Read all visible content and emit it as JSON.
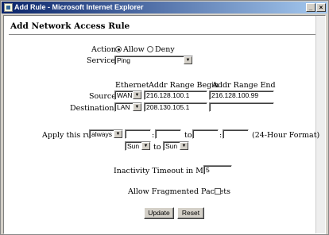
{
  "window": {
    "title": "Add Rule - Microsoft Internet Explorer"
  },
  "page": {
    "heading": "Add Network Access Rule"
  },
  "action": {
    "label": "Action",
    "options": [
      "Allow",
      "Deny"
    ],
    "selected": "Allow"
  },
  "service": {
    "label": "Service",
    "value": "Ping"
  },
  "columns": {
    "ethernet": "Ethernet",
    "begin": "Addr Range Begin",
    "end": "Addr Range End"
  },
  "source": {
    "label": "Source",
    "ethernet": "WAN",
    "begin": "216.128.100.1",
    "end": "216.128.100.99"
  },
  "destination": {
    "label": "Destination",
    "ethernet": "LAN",
    "begin": "208.130.105.1",
    "end": ""
  },
  "schedule": {
    "label": "Apply this rule",
    "mode": "always",
    "start_hour": "",
    "start_min": "",
    "to": "to",
    "end_hour": "",
    "end_min": "",
    "colon": ":",
    "format_note": "(24-Hour Format)",
    "day_start": "Sun",
    "day_to": "to",
    "day_end": "Sun"
  },
  "timeout": {
    "label": "Inactivity Timeout in Minutes",
    "value": "5"
  },
  "fragments": {
    "label": "Allow Fragmented Packets",
    "checked": false
  },
  "buttons": {
    "update": "Update",
    "reset": "Reset"
  }
}
